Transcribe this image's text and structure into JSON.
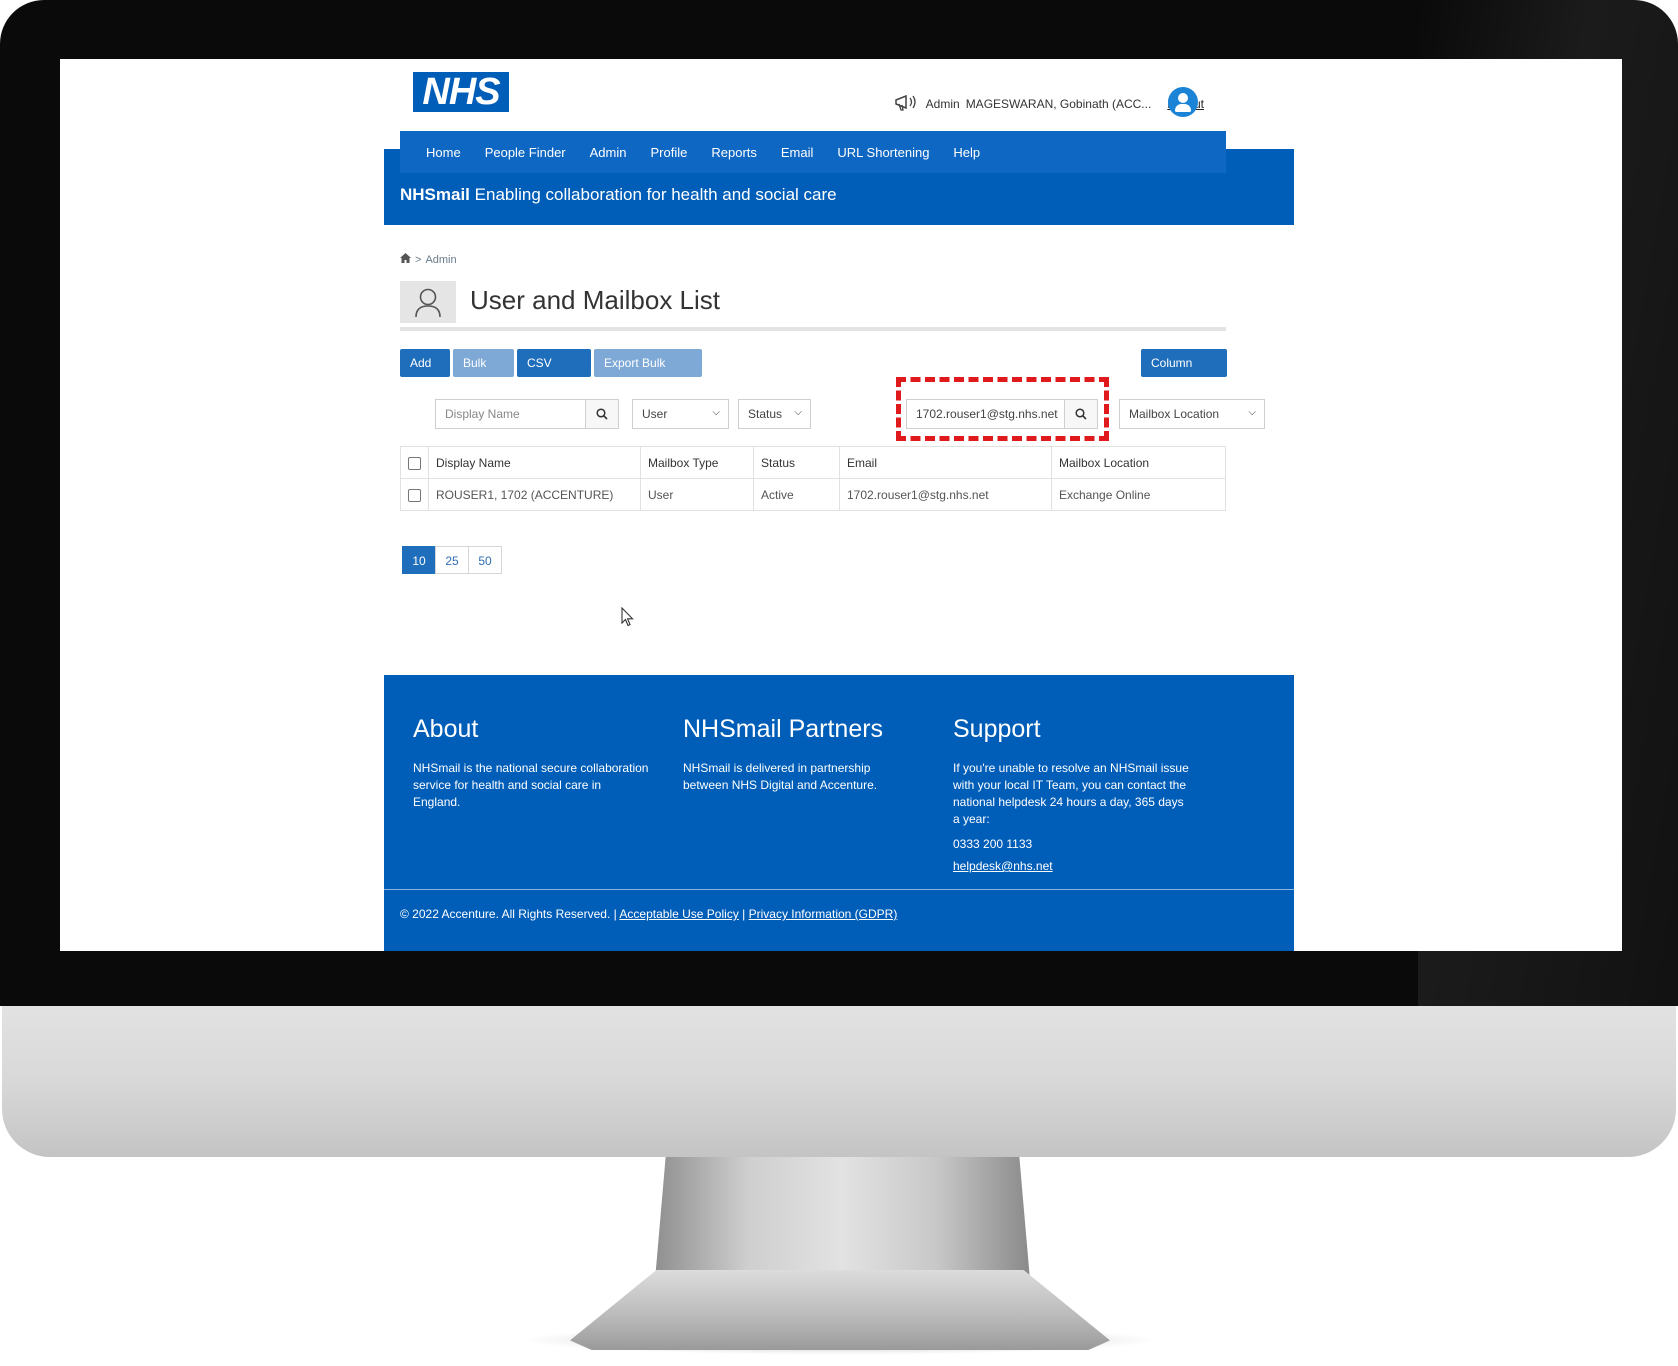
{
  "header": {
    "logo_text": "NHS",
    "user_role": "Admin",
    "user_name": "MAGESWARAN, Gobinath (ACC...",
    "logout_label": "Logout"
  },
  "nav": {
    "items": [
      "Home",
      "People Finder",
      "Admin",
      "Profile",
      "Reports",
      "Email",
      "URL Shortening",
      "Help"
    ]
  },
  "tagline": {
    "brand": "NHSmail",
    "text": "Enabling collaboration for health and social care"
  },
  "breadcrumb": {
    "separator": ">",
    "current": "Admin"
  },
  "page": {
    "title": "User and Mailbox List"
  },
  "toolbar": {
    "add_label": "Add",
    "bulk_edit_label": "Bulk Edit",
    "csv_upload_label": "CSV Upload",
    "export_label": "Export Bulk Details",
    "column_picker_label": "Column Picker"
  },
  "filters": {
    "display_name_placeholder": "Display Name",
    "mailbox_type_value": "User",
    "status_value": "Status",
    "email_value": "1702.rouser1@stg.nhs.net",
    "mailbox_location_value": "Mailbox Location"
  },
  "table": {
    "headers": [
      "Display Name",
      "Mailbox Type",
      "Status",
      "Email",
      "Mailbox Location"
    ],
    "rows": [
      [
        "ROUSER1, 1702 (ACCENTURE)",
        "User",
        "Active",
        "1702.rouser1@stg.nhs.net",
        "Exchange Online"
      ]
    ]
  },
  "pagination": {
    "sizes": [
      "10",
      "25",
      "50"
    ],
    "active": "10"
  },
  "footer": {
    "about_title": "About",
    "about_text": "NHSmail is the national secure collaboration service for health and social care in England.",
    "partners_title": "NHSmail Partners",
    "partners_text": "NHSmail is delivered in partnership between NHS Digital and Accenture.",
    "support_title": "Support",
    "support_text": "If you're unable to resolve an NHSmail issue with your local IT Team, you can contact the national helpdesk 24 hours a day, 365 days a year:",
    "support_phone": "0333 200 1133",
    "support_email": "helpdesk@nhs.net",
    "copyright": "© 2022 Accenture. All Rights Reserved. |",
    "aup_link": "Acceptable Use Policy",
    "divider": "|",
    "privacy_link": "Privacy Information (GDPR)"
  },
  "colors": {
    "nhs_blue": "#005eb8",
    "nav_blue": "#0e67c2",
    "button_blue": "#1f6ebc",
    "button_light": "#7ea9d6",
    "highlight_red": "#e0191c"
  }
}
